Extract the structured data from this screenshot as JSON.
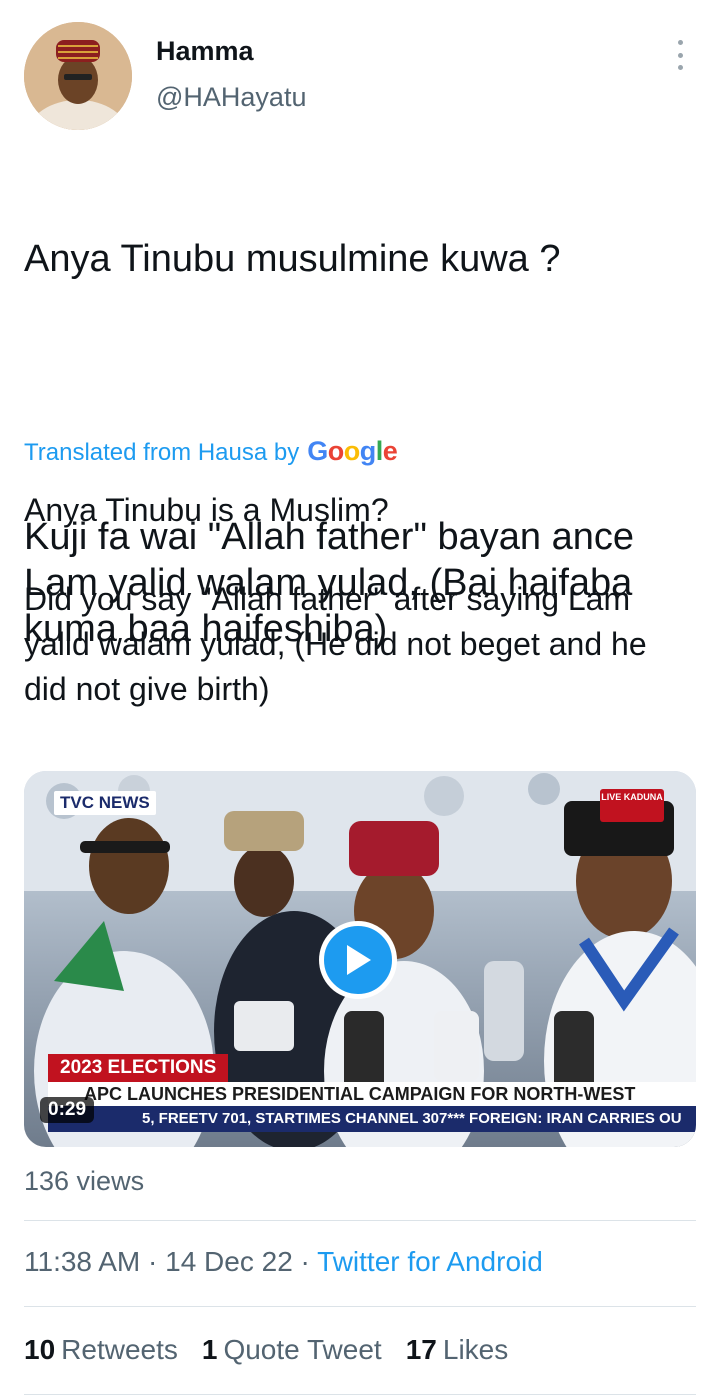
{
  "author": {
    "name": "Hamma",
    "handle": "@HAHayatu"
  },
  "tweet": {
    "line1": "Anya Tinubu musulmine kuwa ?",
    "line2": "Kuji fa wai \"Allah father\" bayan ance Lam yalid walam yulad, (Bai haifaba kuma baa haifeshiba)"
  },
  "translation": {
    "label": "Translated from Hausa by",
    "provider": "Google",
    "line1": "Anya Tinubu is a Muslim?",
    "line2": "Did you say \"Allah father\" after saying Lam yalid walam yulad, (He did not beget and he did not give birth)"
  },
  "media": {
    "channel": "TVC NEWS",
    "live_tag": "LIVE KADUNA",
    "lower_third": "2023 ELECTIONS",
    "headline": "APC LAUNCHES PRESIDENTIAL CAMPAIGN FOR NORTH-WEST",
    "ticker": "5, FREETV 701, STARTIMES CHANNEL 307*** FOREIGN: IRAN CARRIES OU",
    "duration": "0:29"
  },
  "views": "136 views",
  "meta": {
    "time": "11:38 AM",
    "date": "14 Dec 22",
    "source": "Twitter for Android"
  },
  "stats": {
    "retweets_count": "10",
    "retweets_label": "Retweets",
    "quotes_count": "1",
    "quotes_label": "Quote Tweet",
    "likes_count": "17",
    "likes_label": "Likes"
  },
  "colors": {
    "accent": "#1d9bf0",
    "text": "#0f1419",
    "secondary": "#536471"
  }
}
